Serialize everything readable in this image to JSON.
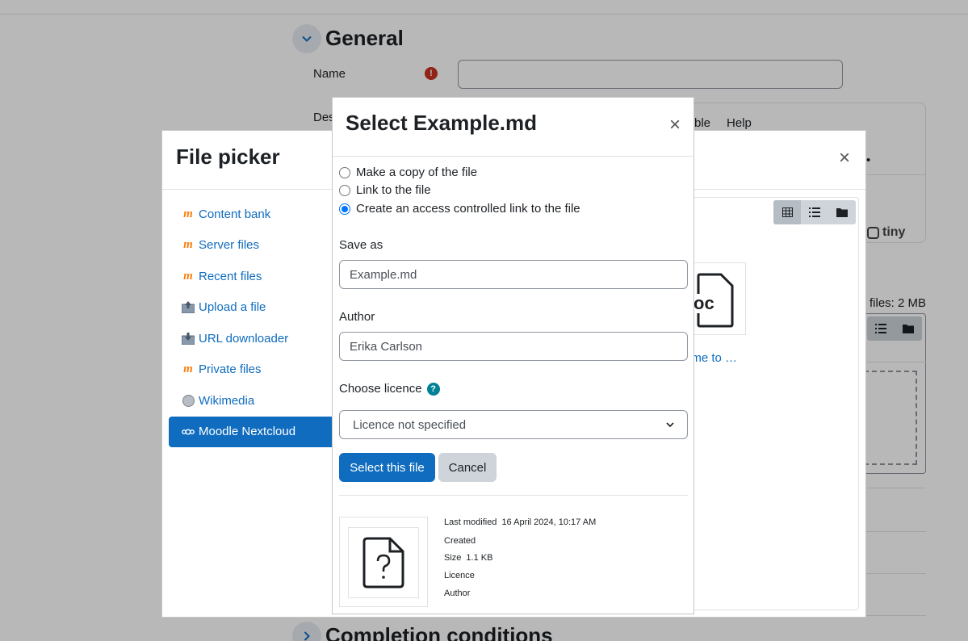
{
  "page": {
    "section_title": "General",
    "name_label": "Name",
    "description_label": "Des",
    "editor_menu": [
      "ble",
      "Help"
    ],
    "editor_dot": "•",
    "tiny_label": "tiny",
    "max_files_label": "files: 2 MB",
    "next_section_title": "Completion conditions"
  },
  "file_picker": {
    "title": "File picker",
    "close": "×",
    "repositories": [
      {
        "label": "Content bank",
        "icon": "moodle-icon"
      },
      {
        "label": "Server files",
        "icon": "moodle-icon"
      },
      {
        "label": "Recent files",
        "icon": "moodle-icon"
      },
      {
        "label": "Upload a file",
        "icon": "upload-icon"
      },
      {
        "label": "URL downloader",
        "icon": "url-download-icon"
      },
      {
        "label": "Private files",
        "icon": "moodle-icon"
      },
      {
        "label": "Wikimedia",
        "icon": "wikimedia-icon"
      },
      {
        "label": "Moodle Nextcloud",
        "icon": "nextcloud-icon"
      }
    ],
    "active_repository": "Moodle Nextcloud",
    "file_name": "ome to …",
    "thumb_text": "oc"
  },
  "select_dialog": {
    "title": "Select Example.md",
    "close": "×",
    "options": [
      {
        "label": "Make a copy of the file",
        "checked": false
      },
      {
        "label": "Link to the file",
        "checked": false
      },
      {
        "label": "Create an access controlled link to the file",
        "checked": true
      }
    ],
    "save_as_label": "Save as",
    "save_as_value": "Example.md",
    "author_label": "Author",
    "author_value": "Erika Carlson",
    "licence_label": "Choose licence",
    "licence_value": "Licence not specified",
    "select_button": "Select this file",
    "cancel_button": "Cancel",
    "meta": {
      "last_modified_label": "Last modified",
      "last_modified_value": "16 April 2024, 10:17 AM",
      "created_label": "Created",
      "size_label": "Size",
      "size_value": "1.1 KB",
      "licence_label": "Licence",
      "author_label": "Author"
    }
  },
  "colors": {
    "primary": "#0f6cbf",
    "required": "#ca3120",
    "help": "#008196"
  }
}
